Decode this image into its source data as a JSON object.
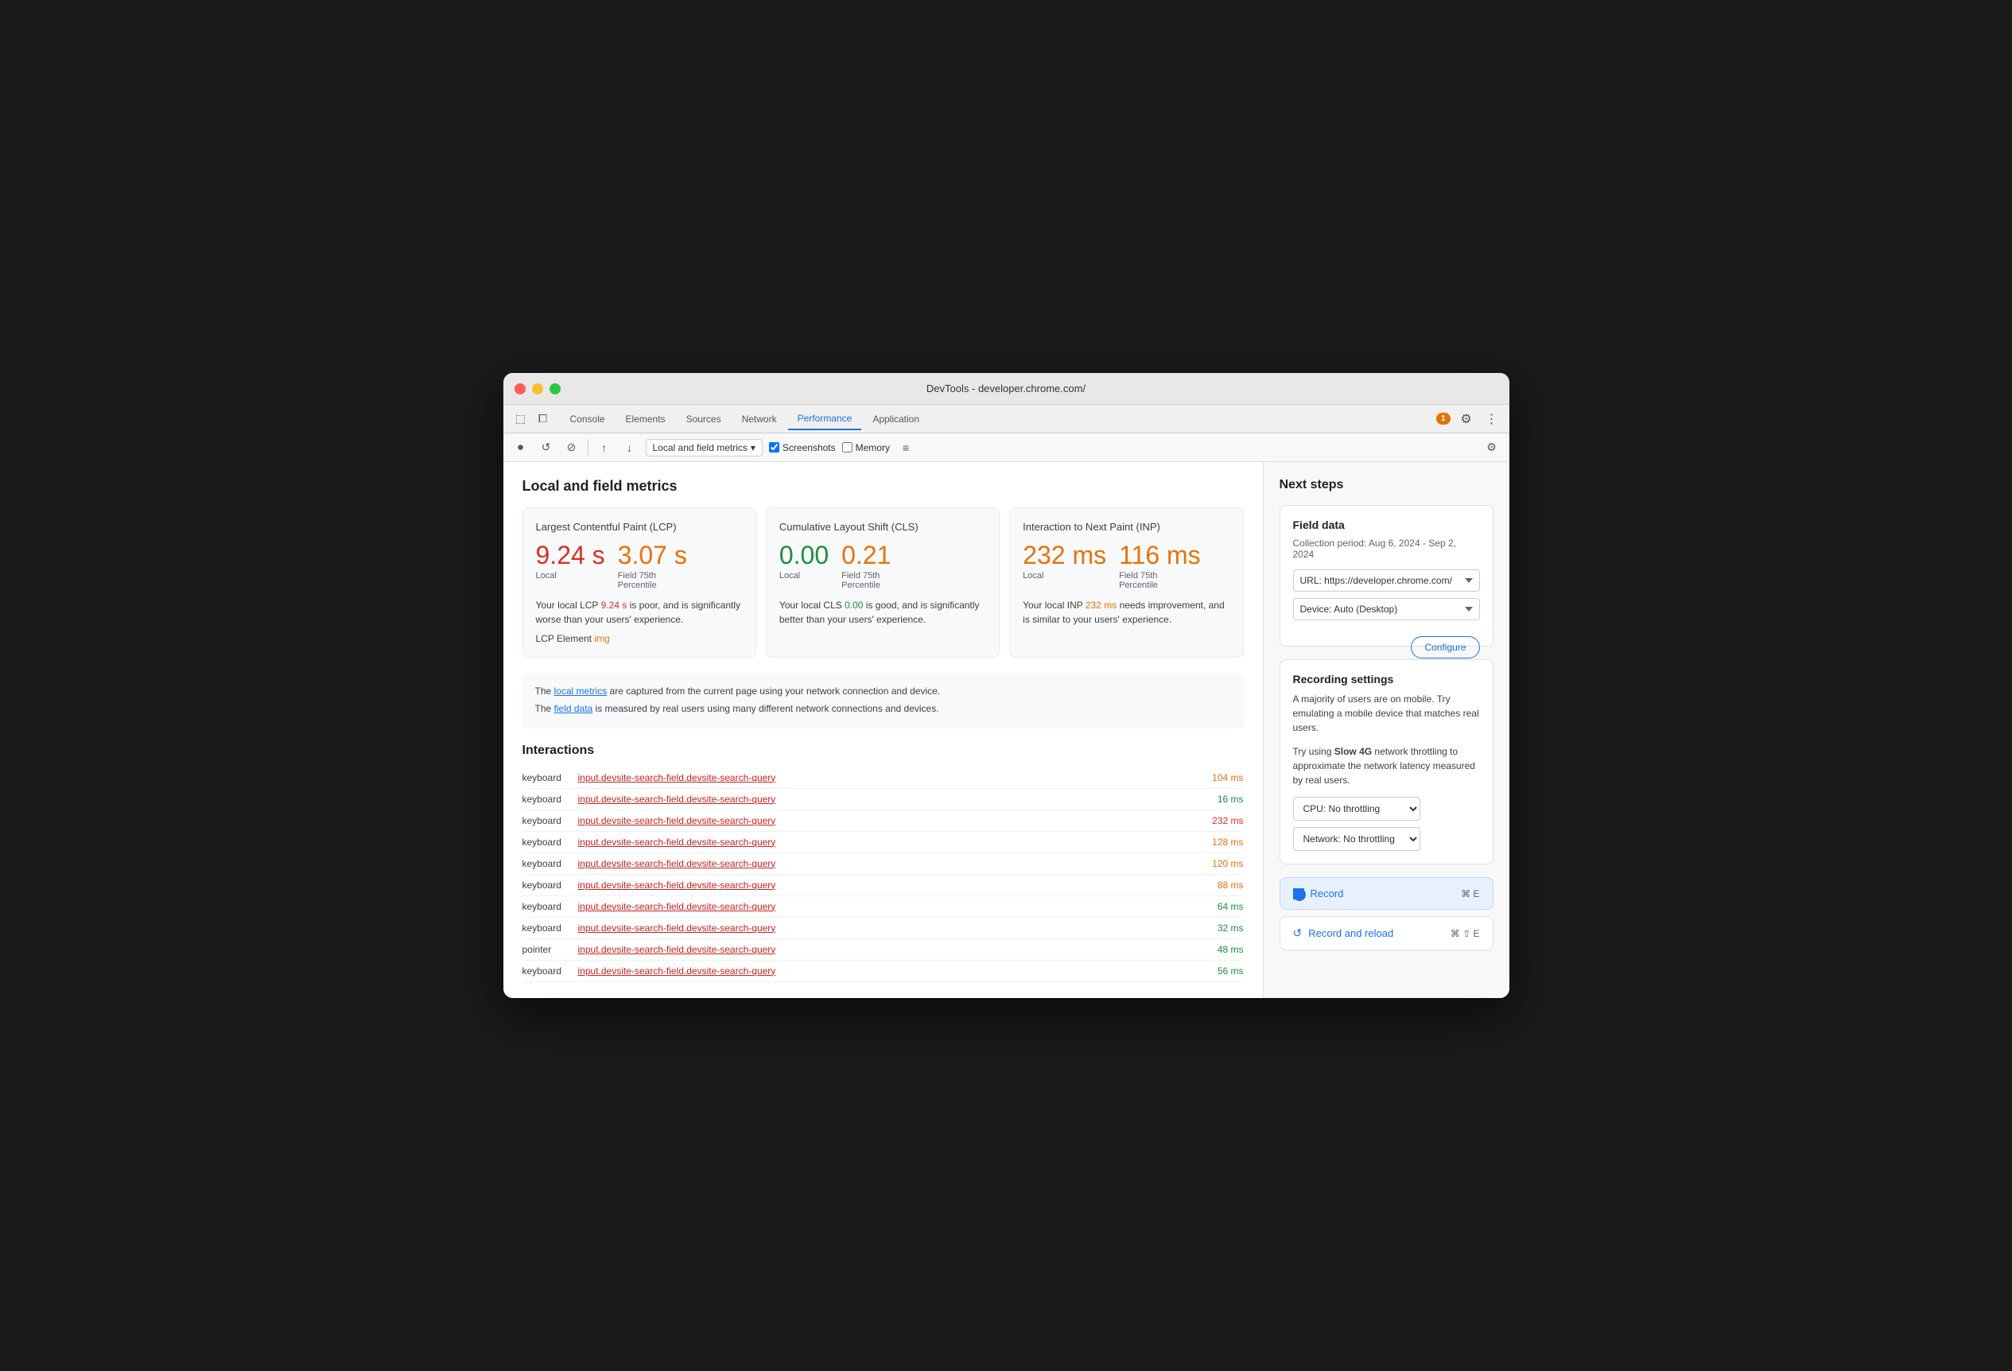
{
  "window": {
    "title": "DevTools - developer.chrome.com/"
  },
  "tabs": [
    {
      "label": "Console",
      "active": false
    },
    {
      "label": "Elements",
      "active": false
    },
    {
      "label": "Sources",
      "active": false
    },
    {
      "label": "Network",
      "active": false
    },
    {
      "label": "Performance",
      "active": true
    },
    {
      "label": "Application",
      "active": false
    }
  ],
  "toolbar": {
    "dropdown_label": "Local and field metrics",
    "screenshots_label": "Screenshots",
    "memory_label": "Memory",
    "screenshots_checked": true,
    "memory_checked": false
  },
  "main": {
    "section_title": "Local and field metrics",
    "metrics": [
      {
        "title": "Largest Contentful Paint (LCP)",
        "local_value": "9.24 s",
        "field_value": "3.07 s",
        "local_label": "Local",
        "field_label": "Field 75th\nPercentile",
        "local_color": "red",
        "field_color": "orange",
        "description": "Your local LCP 9.24 s is poor, and is significantly worse than your users' experience.",
        "description_value": "9.24 s",
        "element_label": "LCP Element",
        "element_value": "img"
      },
      {
        "title": "Cumulative Layout Shift (CLS)",
        "local_value": "0.00",
        "field_value": "0.21",
        "local_label": "Local",
        "field_label": "Field 75th\nPercentile",
        "local_color": "green",
        "field_color": "orange",
        "description": "Your local CLS 0.00 is good, and is significantly better than your users' experience.",
        "description_value": "0.00"
      },
      {
        "title": "Interaction to Next Paint (INP)",
        "local_value": "232 ms",
        "field_value": "116 ms",
        "local_label": "Local",
        "field_label": "Field 75th\nPercentile",
        "local_color": "orange",
        "field_color": "orange",
        "description": "Your local INP 232 ms needs improvement, and is similar to your users' experience.",
        "description_value": "232 ms"
      }
    ],
    "info_line1": "The local metrics are captured from the current page using your network connection and device.",
    "info_line2": "The field data is measured by real users using many different network connections and devices.",
    "interactions_title": "Interactions",
    "interactions": [
      {
        "type": "keyboard",
        "selector": "input.devsite-search-field.devsite-search-query",
        "time": "104 ms",
        "time_color": "orange"
      },
      {
        "type": "keyboard",
        "selector": "input.devsite-search-field.devsite-search-query",
        "time": "16 ms",
        "time_color": "green"
      },
      {
        "type": "keyboard",
        "selector": "input.devsite-search-field.devsite-search-query",
        "time": "232 ms",
        "time_color": "red"
      },
      {
        "type": "keyboard",
        "selector": "input.devsite-search-field.devsite-search-query",
        "time": "128 ms",
        "time_color": "orange"
      },
      {
        "type": "keyboard",
        "selector": "input.devsite-search-field.devsite-search-query",
        "time": "120 ms",
        "time_color": "orange"
      },
      {
        "type": "keyboard",
        "selector": "input.devsite-search-field.devsite-search-query",
        "time": "88 ms",
        "time_color": "orange"
      },
      {
        "type": "keyboard",
        "selector": "input.devsite-search-field.devsite-search-query",
        "time": "64 ms",
        "time_color": "green"
      },
      {
        "type": "keyboard",
        "selector": "input.devsite-search-field.devsite-search-query",
        "time": "32 ms",
        "time_color": "green"
      },
      {
        "type": "pointer",
        "selector": "input.devsite-search-field.devsite-search-query",
        "time": "48 ms",
        "time_color": "green"
      },
      {
        "type": "keyboard",
        "selector": "input.devsite-search-field.devsite-search-query",
        "time": "56 ms",
        "time_color": "green"
      }
    ]
  },
  "right_panel": {
    "title": "Next steps",
    "field_data": {
      "title": "Field data",
      "period": "Collection period: Aug 6, 2024 - Sep 2, 2024",
      "url_label": "URL: https://developer.chrome.com/",
      "device_label": "Device: Auto (Desktop)",
      "configure_label": "Configure"
    },
    "recording_settings": {
      "title": "Recording settings",
      "description": "A majority of users are on mobile. Try emulating a mobile device that matches real users.",
      "description2": "Try using Slow 4G network throttling to approximate the network latency measured by real users.",
      "cpu_label": "CPU: No throttling",
      "network_label": "Network: No throttling",
      "bold_word1": "Slow 4G"
    },
    "record_btn": {
      "label": "Record",
      "shortcut": "⌘ E"
    },
    "record_reload_btn": {
      "label": "Record and reload",
      "shortcut": "⌘ ⇧ E"
    }
  },
  "colors": {
    "red": "#d93025",
    "orange": "#e8710a",
    "green": "#1e8e3e",
    "blue": "#1a73e8",
    "badge_orange": "#e37400"
  }
}
